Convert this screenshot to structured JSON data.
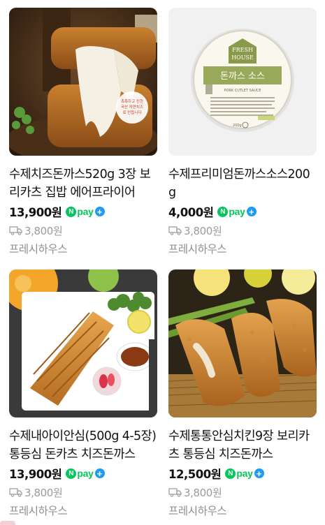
{
  "products": [
    {
      "title": "수제치즈돈까스520g 3장 보리카츠 집밥 에어프라이어",
      "price": "13,900원",
      "shipping": "3,800원",
      "store": "프레시하우스",
      "image_caption": "촉촉하고 진한 국산 자연치즈 로 만듭니다"
    },
    {
      "title": "수제프리미엄돈까스소스200g",
      "price": "4,000원",
      "shipping": "3,800원",
      "store": "프레시하우스",
      "label_brand_top": "FRESH",
      "label_brand_bottom": "HOUSE",
      "label_title": "돈까스 소스",
      "label_subtitle": "PORK CUTLET SAUCE",
      "label_weight": "200g"
    },
    {
      "title": "수제내아이안심(500g 4-5장)통등심 돈카츠 치즈돈까스",
      "price": "13,900원",
      "shipping": "3,800원",
      "store": "프레시하우스"
    },
    {
      "title": "수제통통안심치킨9장 보리카츠 통등심 치즈돈까스",
      "price": "12,500원",
      "shipping": "3,800원",
      "store": "프레시하우스"
    }
  ],
  "npay": {
    "n": "N",
    "text": "pay",
    "plus": "+"
  },
  "icons": {
    "shipping": "truck-icon",
    "payment": "npay-badge-icon"
  },
  "colors": {
    "npay_green": "#03c75a",
    "npay_plus_blue": "#1e9cf5",
    "muted_text": "#9b9b9b"
  }
}
